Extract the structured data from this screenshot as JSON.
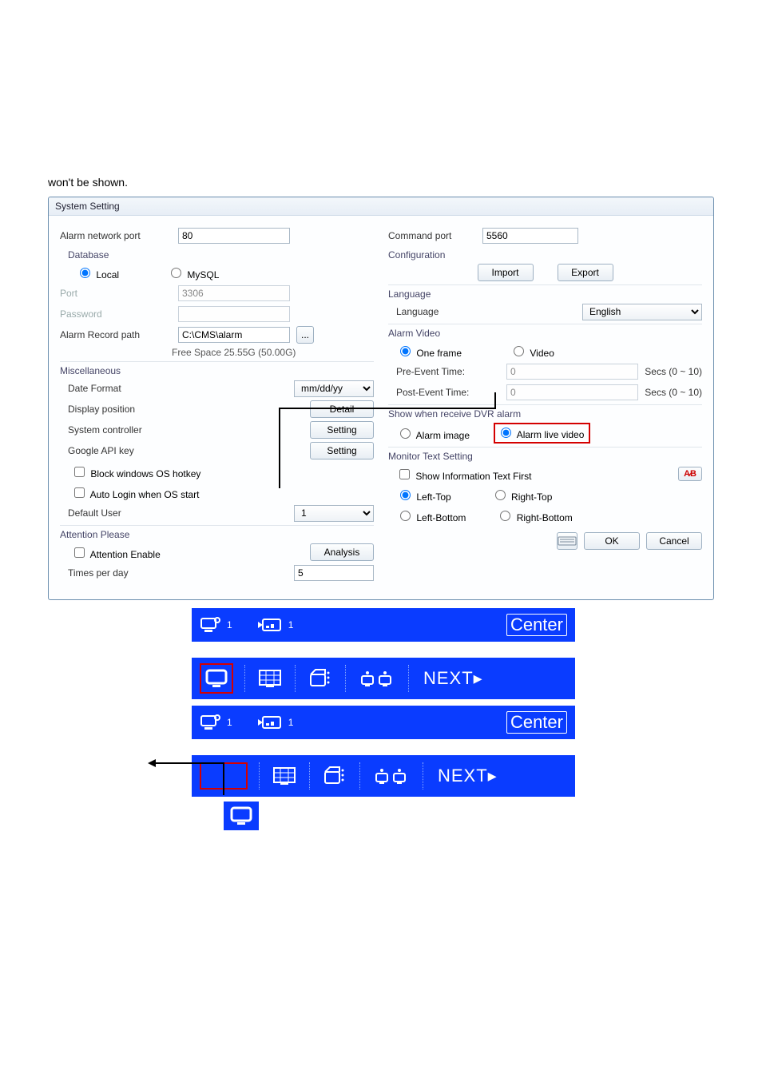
{
  "pretext": "won't be shown.",
  "dialog": {
    "title": "System Setting",
    "left": {
      "alarm_network_port_label": "Alarm network port",
      "alarm_network_port_value": "80",
      "database_title": "Database",
      "db_local": "Local",
      "db_mysql": "MySQL",
      "port_label": "Port",
      "port_value": "3306",
      "password_label": "Password",
      "password_value": "",
      "alarm_record_path_label": "Alarm Record path",
      "alarm_record_path_value": "C:\\CMS\\alarm",
      "browse_btn": "...",
      "free_space": "Free Space 25.55G (50.00G)",
      "misc_title": "Miscellaneous",
      "date_format_label": "Date Format",
      "date_format_value": "mm/dd/yy",
      "display_pos_label": "Display position",
      "detail_btn": "Detail",
      "sys_controller_label": "System controller",
      "setting_btn": "Setting",
      "google_api_label": "Google API key",
      "block_hotkey_label": "Block windows OS hotkey",
      "auto_login_label": "Auto Login when OS start",
      "default_user_label": "Default User",
      "default_user_value": "1",
      "attention_title": "Attention Please",
      "attention_enable_label": "Attention Enable",
      "analysis_btn": "Analysis",
      "times_per_day_label": "Times per day",
      "times_per_day_value": "5"
    },
    "right": {
      "command_port_label": "Command port",
      "command_port_value": "5560",
      "config_title": "Configuration",
      "import_btn": "Import",
      "export_btn": "Export",
      "language_title": "Language",
      "language_label": "Language",
      "language_value": "English",
      "alarm_video_title": "Alarm Video",
      "one_frame": "One frame",
      "video": "Video",
      "pre_event_label": "Pre-Event Time:",
      "pre_event_value": "0",
      "post_event_label": "Post-Event Time:",
      "post_event_value": "0",
      "secs_hint": "Secs  (0 ~ 10)",
      "show_title": "Show when receive DVR alarm",
      "alarm_image": "Alarm image",
      "alarm_live_video": "Alarm live video",
      "monitor_title": "Monitor Text Setting",
      "show_info_first": "Show Information Text First",
      "font_mark": "A̷B",
      "left_top": "Left-Top",
      "right_top": "Right-Top",
      "left_bottom": "Left-Bottom",
      "right_bottom": "Right-Bottom",
      "ok_btn": "OK",
      "cancel_btn": "Cancel"
    }
  },
  "bars": {
    "badge1": "1",
    "rec1": "1",
    "center": "Center",
    "next": "NEXT▸"
  }
}
